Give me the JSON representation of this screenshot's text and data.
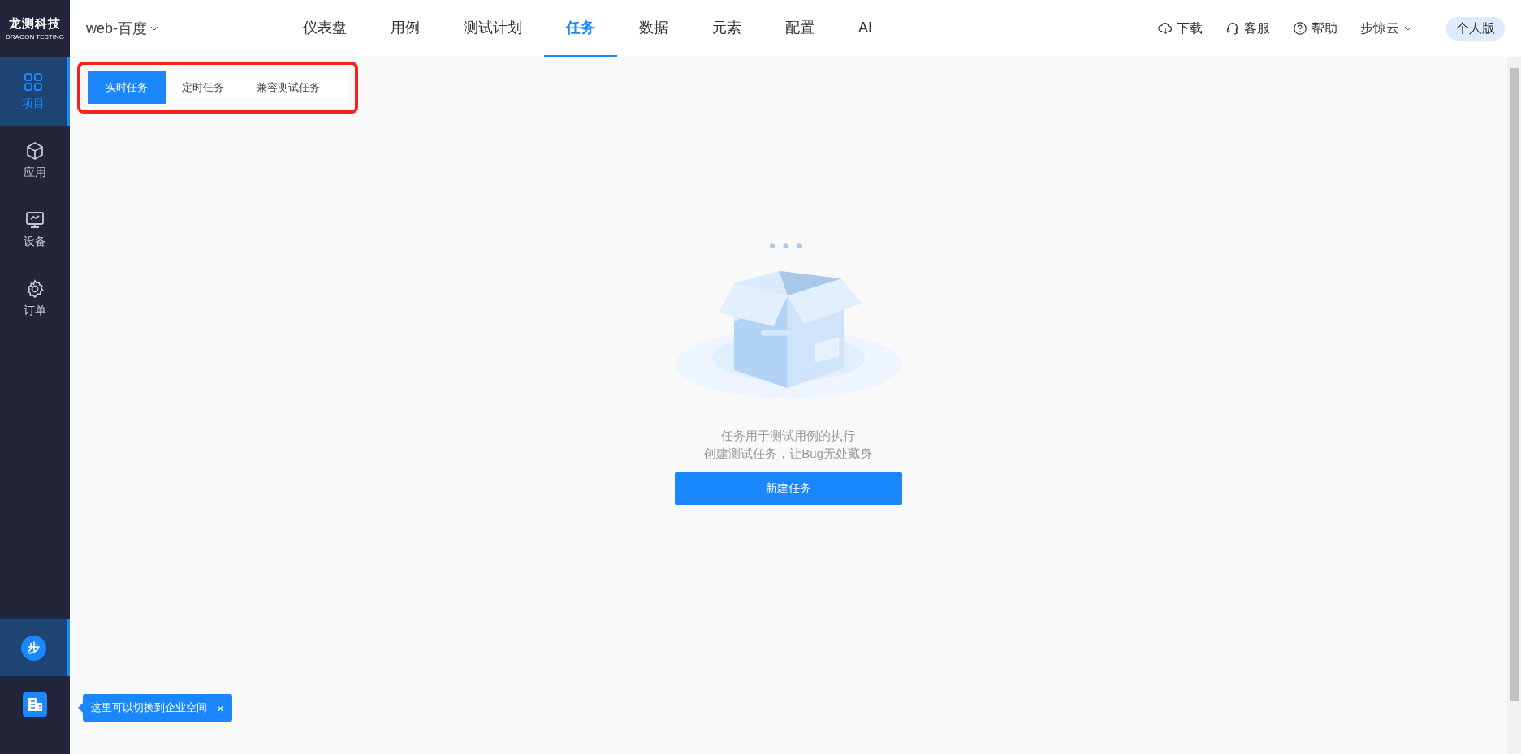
{
  "logo": {
    "title": "龙测科技",
    "subtitle": "DRAGON TESTING"
  },
  "project": {
    "name": "web-百度"
  },
  "nav": [
    {
      "label": "仪表盘",
      "selected": false
    },
    {
      "label": "用例",
      "selected": false
    },
    {
      "label": "测试计划",
      "selected": false
    },
    {
      "label": "任务",
      "selected": true
    },
    {
      "label": "数据",
      "selected": false
    },
    {
      "label": "元素",
      "selected": false
    },
    {
      "label": "配置",
      "selected": false
    },
    {
      "label": "AI",
      "selected": false
    }
  ],
  "header_actions": [
    {
      "kind": "download",
      "label": "下载"
    },
    {
      "kind": "service",
      "label": "客服"
    },
    {
      "kind": "help",
      "label": "帮助"
    }
  ],
  "user": {
    "name": "步惊云",
    "edition": "个人版"
  },
  "sidebar": {
    "items": [
      {
        "kind": "project",
        "label": "项目",
        "selected": true
      },
      {
        "kind": "app",
        "label": "应用",
        "selected": false
      },
      {
        "kind": "device",
        "label": "设备",
        "selected": false
      },
      {
        "kind": "order",
        "label": "订单",
        "selected": false
      }
    ],
    "avatar": {
      "text": "步",
      "selected": true
    }
  },
  "tooltip": {
    "text": "这里可以切换到企业空间",
    "close": "×"
  },
  "task_tabs": [
    {
      "label": "实时任务",
      "selected": true
    },
    {
      "label": "定时任务",
      "selected": false
    },
    {
      "label": "兼容测试任务",
      "selected": false
    }
  ],
  "empty_state": {
    "lines": [
      "任务用于测试用例的执行",
      "创建测试任务，让Bug无处藏身"
    ],
    "button": "新建任务"
  }
}
